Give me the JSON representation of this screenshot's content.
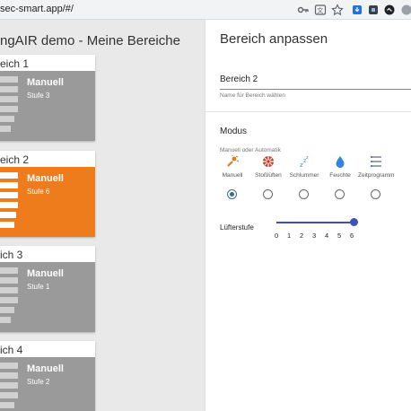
{
  "browser": {
    "url": "sec-smart.app/#/"
  },
  "page_title": "ngAIR demo - Meine Bereiche",
  "areas": [
    {
      "header": "eich 1",
      "mode": "Manuell",
      "level": "Stufe 3",
      "active": false
    },
    {
      "header": "eich 2",
      "mode": "Manuell",
      "level": "Stufe 6",
      "active": true
    },
    {
      "header": "ich 3",
      "mode": "Manuell",
      "level": "Stufe 1",
      "active": false
    },
    {
      "header": "ich 4",
      "mode": "Manuell",
      "level": "Stufe 2",
      "active": false
    }
  ],
  "panel": {
    "title": "Bereich anpassen",
    "name_value": "Bereich 2",
    "name_hint": "Name für Bereich wählen",
    "modus_title": "Modus",
    "modus_hint": "Manuell oder Automatik",
    "modes": [
      {
        "label": "Manuell",
        "icon": "manual-fan-icon",
        "selected": true
      },
      {
        "label": "Stoßlüften",
        "icon": "burst-ventilation-icon",
        "selected": false
      },
      {
        "label": "Schlummer",
        "icon": "sleep-icon",
        "selected": false
      },
      {
        "label": "Feuchte",
        "icon": "humidity-drop-icon",
        "selected": false
      },
      {
        "label": "Zeitprogramm",
        "icon": "schedule-icon",
        "selected": false
      }
    ],
    "fan_label": "Lüfterstufe",
    "fan_ticks": [
      "0",
      "1",
      "2",
      "3",
      "4",
      "5",
      "6"
    ],
    "fan_value": 6,
    "slider_color": "#3f51b5",
    "accent_color": "#ee7c1c"
  }
}
